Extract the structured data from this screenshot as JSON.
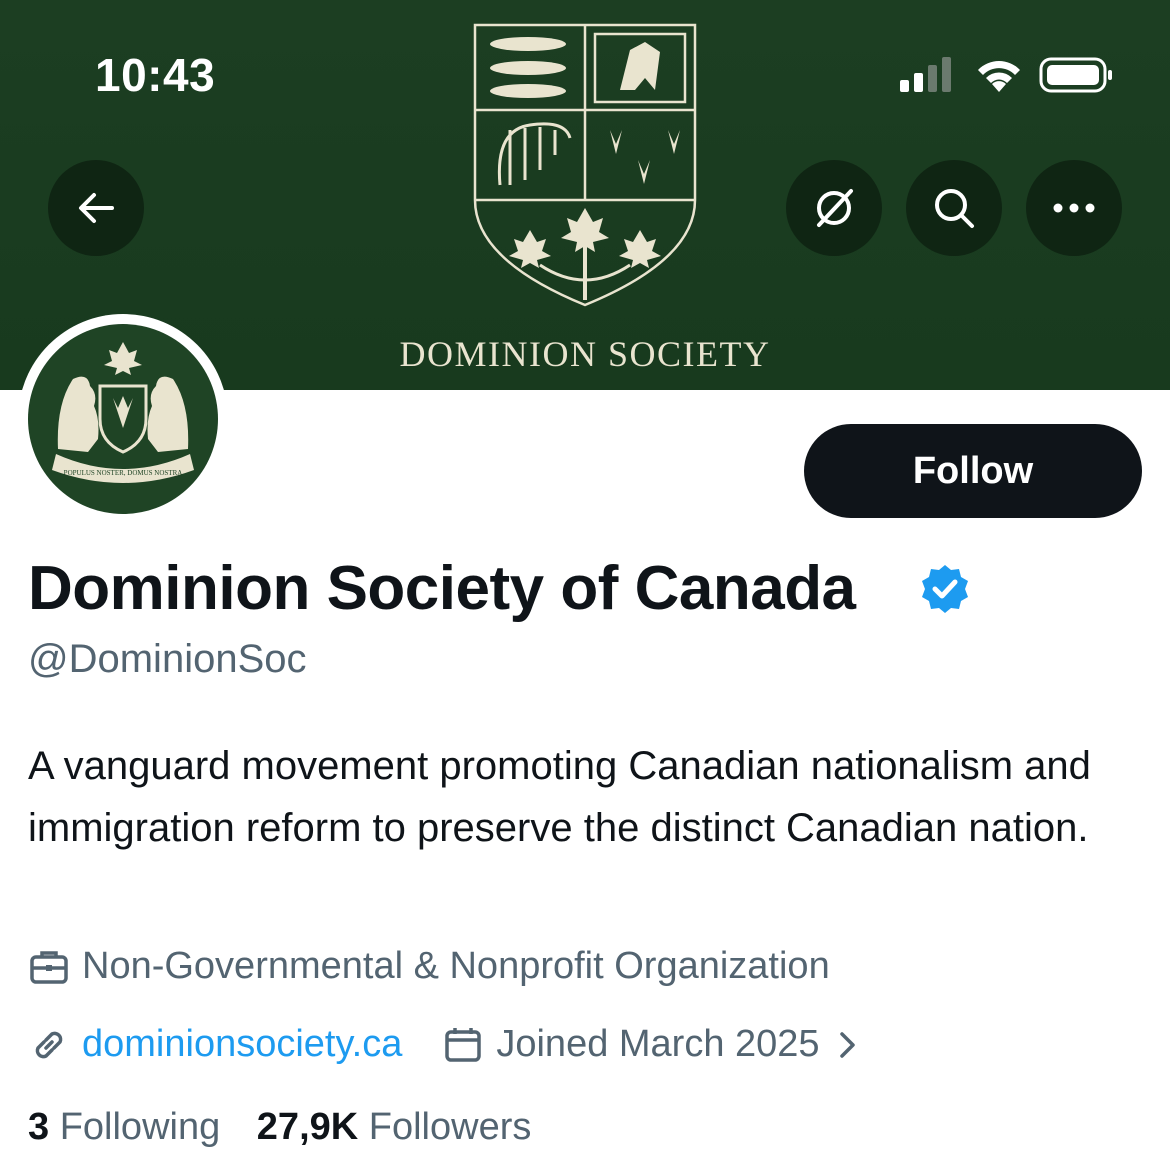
{
  "status_bar": {
    "time": "10:43"
  },
  "banner": {
    "title": "DOMINION SOCIETY",
    "colors": {
      "background": "#1a3a20",
      "ink": "#e9e4cf"
    }
  },
  "header_actions": {
    "back_icon": "arrow-left-icon",
    "grok_icon": "slashed-circle-icon",
    "search_icon": "search-icon",
    "more_icon": "more-horizontal-icon"
  },
  "avatar": {
    "motto": "POPULUS NOSTER, DOMUS NOSTRA"
  },
  "follow_button": {
    "label": "Follow"
  },
  "profile": {
    "display_name": "Dominion Society of Canada",
    "handle": "@DominionSoc",
    "bio": "A vanguard movement promoting Canadian nationalism and immigration reform to preserve the distinct Canadian nation.",
    "category": "Non-Governmental & Nonprofit Organization",
    "website": "dominionsociety.ca",
    "joined": "Joined March 2025"
  },
  "stats": {
    "following_count": "3",
    "following_label": "Following",
    "followers_count": "27,9K",
    "followers_label": "Followers"
  },
  "colors": {
    "link": "#1d9bf0",
    "secondary_text": "#536471",
    "verified": "#1d9bf0"
  }
}
